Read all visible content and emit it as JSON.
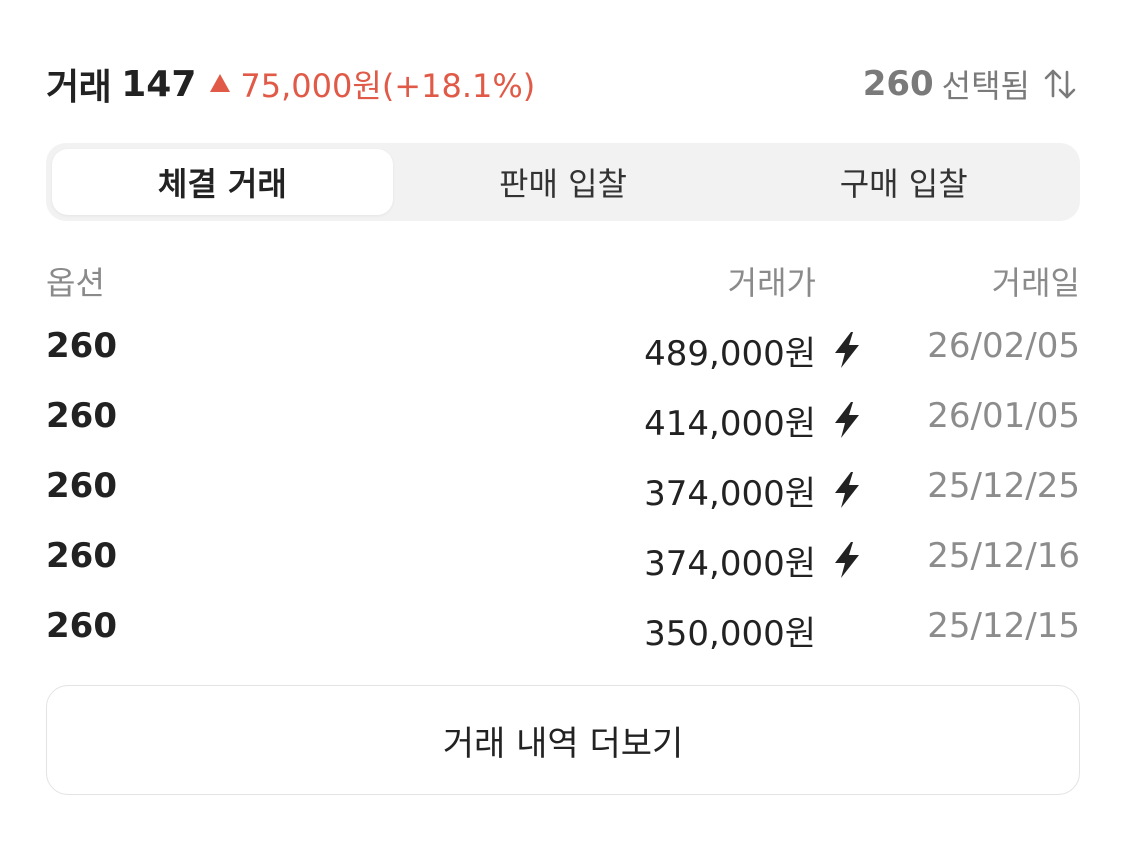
{
  "header": {
    "title": "거래",
    "count": "147",
    "change_text": "75,000원(+18.1%)",
    "selected_size": "260",
    "selected_label": "선택됨",
    "accent_color": "#e05a47"
  },
  "tabs": [
    {
      "label": "체결 거래",
      "active": true
    },
    {
      "label": "판매 입찰",
      "active": false
    },
    {
      "label": "구매 입찰",
      "active": false
    }
  ],
  "table": {
    "columns": {
      "option": "옵션",
      "price": "거래가",
      "date": "거래일"
    },
    "rows": [
      {
        "option": "260",
        "price": "489,000원",
        "quick": true,
        "date": "26/02/05"
      },
      {
        "option": "260",
        "price": "414,000원",
        "quick": true,
        "date": "26/01/05"
      },
      {
        "option": "260",
        "price": "374,000원",
        "quick": true,
        "date": "25/12/25"
      },
      {
        "option": "260",
        "price": "374,000원",
        "quick": true,
        "date": "25/12/16"
      },
      {
        "option": "260",
        "price": "350,000원",
        "quick": false,
        "date": "25/12/15"
      }
    ]
  },
  "more_button": {
    "label": "거래 내역 더보기"
  },
  "icons": {
    "change_indicator": "triangle-up-icon",
    "sort": "sort-icon",
    "quick_delivery": "bolt-icon"
  }
}
